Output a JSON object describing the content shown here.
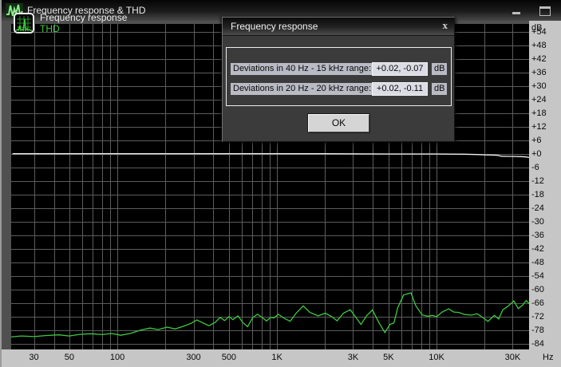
{
  "window": {
    "title": "Frequency response & THD"
  },
  "legend": {
    "items": [
      {
        "label": "Frequency response",
        "color": "#f0f0f0"
      },
      {
        "label": "THD",
        "color": "#3fc93f"
      }
    ]
  },
  "dialog": {
    "title": "Frequency response",
    "close_glyph": "x",
    "rows": [
      {
        "label": "Deviations in 40 Hz - 15 kHz range:",
        "value": "+0.02, -0.07",
        "unit": "dB"
      },
      {
        "label": "Deviations in 20 Hz - 20 kHz range:",
        "value": "+0.02, -0.11",
        "unit": "dB"
      }
    ],
    "ok_label": "OK"
  },
  "axes": {
    "y_unit_label": "dB",
    "x_unit_label": "Hz",
    "y_labels": [
      {
        "text": "+54",
        "db": 54
      },
      {
        "text": "+48",
        "db": 48
      },
      {
        "text": "+42",
        "db": 42
      },
      {
        "text": "+36",
        "db": 36
      },
      {
        "text": "+30",
        "db": 30
      },
      {
        "text": "+24",
        "db": 24
      },
      {
        "text": "+18",
        "db": 18
      },
      {
        "text": "+12",
        "db": 12
      },
      {
        "text": "+6",
        "db": 6
      },
      {
        "text": "+0",
        "db": 0
      },
      {
        "text": "-6",
        "db": -6
      },
      {
        "text": "-12",
        "db": -12
      },
      {
        "text": "-18",
        "db": -18
      },
      {
        "text": "-24",
        "db": -24
      },
      {
        "text": "-30",
        "db": -30
      },
      {
        "text": "-36",
        "db": -36
      },
      {
        "text": "-42",
        "db": -42
      },
      {
        "text": "-48",
        "db": -48
      },
      {
        "text": "-54",
        "db": -54
      },
      {
        "text": "-60",
        "db": -60
      },
      {
        "text": "-66",
        "db": -66
      },
      {
        "text": "-72",
        "db": -72
      },
      {
        "text": "-78",
        "db": -78
      },
      {
        "text": "-84",
        "db": -84
      }
    ],
    "x_labels": [
      {
        "text": "30",
        "f": 30
      },
      {
        "text": "50",
        "f": 50
      },
      {
        "text": "100",
        "f": 100
      },
      {
        "text": "300",
        "f": 300
      },
      {
        "text": "500",
        "f": 500
      },
      {
        "text": "1K",
        "f": 1000
      },
      {
        "text": "3K",
        "f": 3000
      },
      {
        "text": "5K",
        "f": 5000
      },
      {
        "text": "10K",
        "f": 10000
      },
      {
        "text": "30K",
        "f": 30000
      }
    ],
    "grid_freqs": [
      30,
      40,
      50,
      60,
      70,
      80,
      90,
      100,
      200,
      300,
      400,
      500,
      600,
      700,
      800,
      900,
      1000,
      2000,
      3000,
      4000,
      5000,
      6000,
      7000,
      8000,
      9000,
      10000,
      20000,
      30000
    ],
    "colors": {
      "plot_bg": "#000000",
      "grid": "#5c5c5c",
      "axis_strip_bg": "#c6c6c6"
    }
  },
  "chart_data": {
    "type": "line",
    "title": "Frequency response & THD",
    "x_axis": {
      "scale": "log",
      "unit": "Hz",
      "min": 21.6,
      "max": 38000
    },
    "y_axis": {
      "unit": "dB",
      "min": -84,
      "max": 54,
      "step": 6,
      "grid": true
    },
    "legend_position": "top-left",
    "series": [
      {
        "name": "Frequency response",
        "color": "#f2f2f2",
        "points": [
          [
            22,
            0.1
          ],
          [
            2000,
            0.1
          ],
          [
            5000,
            0
          ],
          [
            10000,
            0
          ],
          [
            15000,
            -0.1
          ],
          [
            18000,
            -0.25
          ],
          [
            20000,
            -0.4
          ],
          [
            22500,
            -0.5
          ],
          [
            24000,
            -0.55
          ],
          [
            25500,
            -1.0
          ],
          [
            28000,
            -1.05
          ],
          [
            31000,
            -1.1
          ],
          [
            34000,
            -1.15
          ],
          [
            36500,
            -1.3
          ],
          [
            38000,
            -1.55
          ]
        ]
      },
      {
        "name": "THD",
        "color": "#3fc93f",
        "points": [
          [
            21,
            -81
          ],
          [
            25,
            -80.5
          ],
          [
            30,
            -80.8
          ],
          [
            36,
            -80.3
          ],
          [
            43,
            -80
          ],
          [
            50,
            -80.5
          ],
          [
            58,
            -79.8
          ],
          [
            68,
            -79.5
          ],
          [
            80,
            -79.9
          ],
          [
            92,
            -79.4
          ],
          [
            105,
            -80.2
          ],
          [
            120,
            -79.4
          ],
          [
            140,
            -77.9
          ],
          [
            160,
            -77
          ],
          [
            180,
            -77.7
          ],
          [
            205,
            -76.6
          ],
          [
            230,
            -77.4
          ],
          [
            260,
            -76.2
          ],
          [
            290,
            -74.9
          ],
          [
            315,
            -73.4
          ],
          [
            345,
            -74.8
          ],
          [
            375,
            -76
          ],
          [
            410,
            -74.5
          ],
          [
            440,
            -72.3
          ],
          [
            470,
            -73.7
          ],
          [
            500,
            -71.9
          ],
          [
            530,
            -73.3
          ],
          [
            570,
            -71.6
          ],
          [
            610,
            -74.5
          ],
          [
            655,
            -76.4
          ],
          [
            705,
            -72.4
          ],
          [
            755,
            -70.9
          ],
          [
            810,
            -72.4
          ],
          [
            860,
            -73.9
          ],
          [
            910,
            -72.3
          ],
          [
            960,
            -72.5
          ],
          [
            1020,
            -70.9
          ],
          [
            1110,
            -72.7
          ],
          [
            1210,
            -74
          ],
          [
            1320,
            -70.4
          ],
          [
            1460,
            -67.2
          ],
          [
            1610,
            -70.1
          ],
          [
            1810,
            -71.6
          ],
          [
            2010,
            -70.4
          ],
          [
            2210,
            -72
          ],
          [
            2380,
            -73.8
          ],
          [
            2610,
            -70.4
          ],
          [
            2880,
            -68.9
          ],
          [
            3110,
            -72.1
          ],
          [
            3360,
            -75.4
          ],
          [
            3660,
            -71.4
          ],
          [
            3970,
            -69
          ],
          [
            4310,
            -74.1
          ],
          [
            4740,
            -79
          ],
          [
            5110,
            -75.4
          ],
          [
            5410,
            -74.7
          ],
          [
            5710,
            -68
          ],
          [
            6210,
            -62.4
          ],
          [
            6910,
            -61.4
          ],
          [
            7410,
            -67.1
          ],
          [
            8110,
            -71.2
          ],
          [
            8810,
            -71.8
          ],
          [
            9410,
            -71.4
          ],
          [
            10010,
            -72
          ],
          [
            10810,
            -70
          ],
          [
            11910,
            -68.5
          ],
          [
            12810,
            -69.9
          ],
          [
            13810,
            -70.1
          ],
          [
            15010,
            -71
          ],
          [
            16510,
            -71.3
          ],
          [
            18010,
            -70.7
          ],
          [
            19510,
            -72.4
          ],
          [
            21010,
            -74.1
          ],
          [
            23010,
            -71.4
          ],
          [
            24510,
            -73
          ],
          [
            26010,
            -68.9
          ],
          [
            28010,
            -67.4
          ],
          [
            30510,
            -65
          ],
          [
            32510,
            -68.4
          ],
          [
            34510,
            -67
          ],
          [
            36510,
            -64.8
          ],
          [
            38000,
            -66.2
          ]
        ]
      }
    ]
  }
}
